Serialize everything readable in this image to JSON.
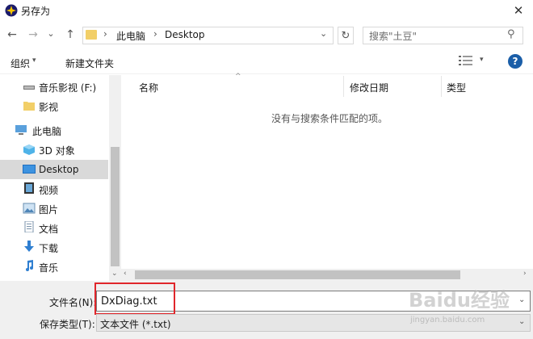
{
  "window": {
    "title": "另存为",
    "close_glyph": "✕"
  },
  "nav": {
    "back_glyph": "←",
    "forward_glyph": "→",
    "recent_glyph": "⌄",
    "up_glyph": "↑",
    "breadcrumb_sep": "›",
    "breadcrumb": [
      "此电脑",
      "Desktop"
    ],
    "address_dropdown_glyph": "⌄",
    "refresh_glyph": "↻",
    "search_placeholder": "搜索\"土豆\"",
    "search_glyph": "⚲"
  },
  "toolbar": {
    "organize": "组织",
    "new_folder": "新建文件夹",
    "help": "?",
    "dropdown_glyph": "▾"
  },
  "sidebar": {
    "items": [
      {
        "label": "音乐影视 (F:)",
        "icon": "drive-icon"
      },
      {
        "label": "影视",
        "icon": "folder-icon"
      },
      {
        "label": "此电脑",
        "icon": "computer-icon"
      },
      {
        "label": "3D 对象",
        "icon": "3d-objects-icon"
      },
      {
        "label": "Desktop",
        "icon": "desktop-icon",
        "selected": true
      },
      {
        "label": "视频",
        "icon": "video-icon"
      },
      {
        "label": "图片",
        "icon": "pictures-icon"
      },
      {
        "label": "文档",
        "icon": "documents-icon"
      },
      {
        "label": "下载",
        "icon": "downloads-icon"
      },
      {
        "label": "音乐",
        "icon": "music-icon"
      }
    ]
  },
  "content": {
    "columns": [
      "名称",
      "修改日期",
      "类型"
    ],
    "sort_glyph": "^",
    "empty_message": "没有与搜索条件匹配的项。"
  },
  "scroll": {
    "left_glyph": "‹",
    "right_glyph": "›",
    "down_glyph": "⌄"
  },
  "bottom": {
    "filename_label": "文件名(N):",
    "filename_value": "DxDiag.txt",
    "filetype_label": "保存类型(T):",
    "filetype_value": "文本文件 (*.txt)",
    "dropdown_glyph": "⌄"
  },
  "watermark": {
    "main": "Baidu经验",
    "sub": "jingyan.baidu.com"
  },
  "colors": {
    "highlight": "#e0262b",
    "selected_bg": "#d9d9d9",
    "accent": "#1a5ea8"
  }
}
